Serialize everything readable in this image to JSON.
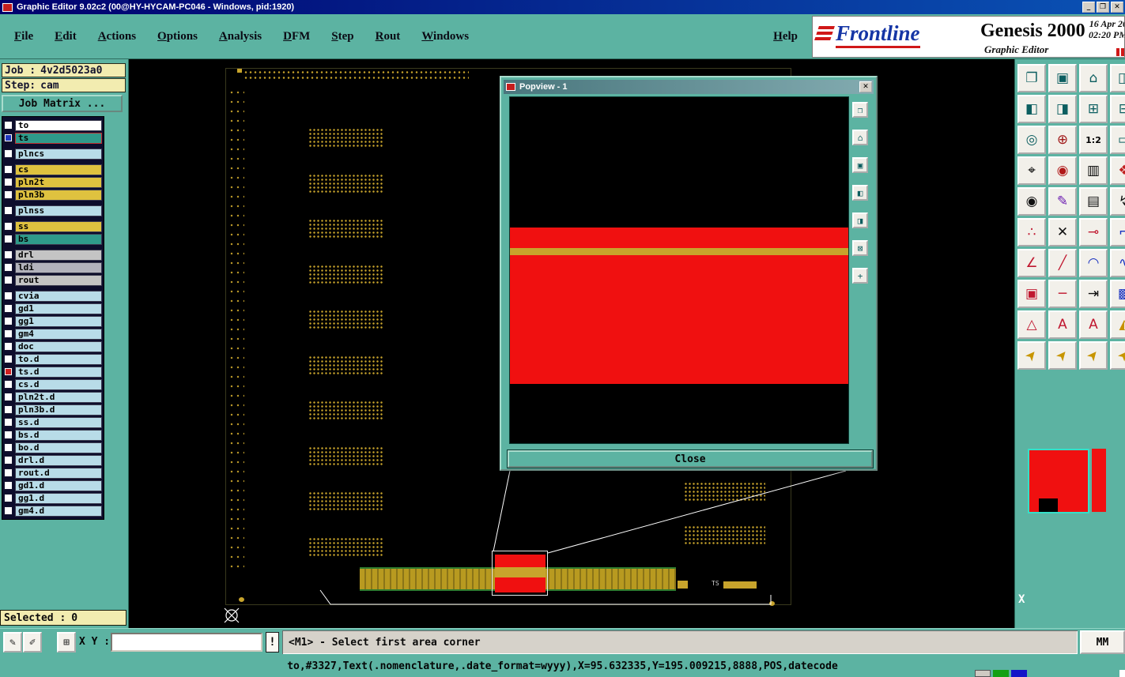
{
  "window": {
    "title": "Graphic Editor 9.02c2 (00@HY-HYCAM-PC046 - Windows, pid:1920)",
    "controls": {
      "minimize": "_",
      "maximize": "❐",
      "close": "✕"
    }
  },
  "menu": {
    "items": [
      "File",
      "Edit",
      "Actions",
      "Options",
      "Analysis",
      "DFM",
      "Step",
      "Rout",
      "Windows"
    ],
    "help": "Help"
  },
  "brand": {
    "logo": "Frontline",
    "product": "Genesis 2000",
    "date": "16 Apr 20",
    "time": "02:20 PM",
    "subtitle": "Graphic Editor"
  },
  "sidebar": {
    "job": {
      "label": "Job :",
      "value": "4v2d5023a0"
    },
    "step": {
      "label": "Step:",
      "value": "cam"
    },
    "matrix_button": "Job Matrix ...",
    "selected": {
      "label": "Selected :",
      "value": "0"
    },
    "layers": [
      {
        "name": "to",
        "bg": "#ffffff"
      },
      {
        "name": "ts",
        "bg": "#2f9a8a",
        "check": "#2038c0",
        "selected": true
      },
      {
        "name": "plncs",
        "bg": "#b8dce8",
        "gap": true
      },
      {
        "name": "cs",
        "bg": "#dfc23f",
        "gap": true
      },
      {
        "name": "pln2t",
        "bg": "#dfc23f"
      },
      {
        "name": "pln3b",
        "bg": "#dfc23f"
      },
      {
        "name": "plnss",
        "bg": "#b8dce8",
        "gap": true
      },
      {
        "name": "ss",
        "bg": "#dfc23f",
        "gap": true
      },
      {
        "name": "bs",
        "bg": "#2f9a8a"
      },
      {
        "name": "drl",
        "bg": "#c4c4c4",
        "gap": true
      },
      {
        "name": "ldi",
        "bg": "#b2b2bc"
      },
      {
        "name": "rout",
        "bg": "#c4c4c4"
      },
      {
        "name": "cvia",
        "bg": "#b8dce8",
        "gap": true
      },
      {
        "name": "gd1",
        "bg": "#b8dce8"
      },
      {
        "name": "gg1",
        "bg": "#b8dce8"
      },
      {
        "name": "gm4",
        "bg": "#b8dce8"
      },
      {
        "name": "doc",
        "bg": "#b8dce8"
      },
      {
        "name": "to.d",
        "bg": "#b8dce8"
      },
      {
        "name": "ts.d",
        "bg": "#b8dce8",
        "check": "#d02020"
      },
      {
        "name": "cs.d",
        "bg": "#b8dce8"
      },
      {
        "name": "pln2t.d",
        "bg": "#b8dce8"
      },
      {
        "name": "pln3b.d",
        "bg": "#b8dce8"
      },
      {
        "name": "ss.d",
        "bg": "#b8dce8"
      },
      {
        "name": "bs.d",
        "bg": "#b8dce8"
      },
      {
        "name": "bo.d",
        "bg": "#b8dce8"
      },
      {
        "name": "drl.d",
        "bg": "#b8dce8"
      },
      {
        "name": "rout.d",
        "bg": "#b8dce8"
      },
      {
        "name": "gd1.d",
        "bg": "#b8dce8"
      },
      {
        "name": "gg1.d",
        "bg": "#b8dce8"
      },
      {
        "name": "gm4.d",
        "bg": "#b8dce8"
      }
    ]
  },
  "canvas": {
    "ts_label": "TS"
  },
  "popview": {
    "title": "Popview - 1",
    "close_glyph": "✕",
    "close_label": "Close",
    "buttons": [
      {
        "name": "copy-window",
        "glyph": "❐"
      },
      {
        "name": "home-view",
        "glyph": "⌂"
      },
      {
        "name": "screen-view",
        "glyph": "▣"
      },
      {
        "name": "pan-left",
        "glyph": "◧"
      },
      {
        "name": "pan-right",
        "glyph": "◨"
      },
      {
        "name": "zoom-fit",
        "glyph": "⊠"
      },
      {
        "name": "pan-move",
        "glyph": "+"
      }
    ]
  },
  "toolbar": {
    "buttons": [
      {
        "name": "view-capture",
        "glyph": "❐",
        "color": "#0c5e60"
      },
      {
        "name": "view-screen",
        "glyph": "▣",
        "color": "#0c5e60"
      },
      {
        "name": "view-home",
        "glyph": "⌂",
        "color": "#0c5e60"
      },
      {
        "name": "view-window",
        "glyph": "◫",
        "color": "#0c5e60"
      },
      {
        "name": "pan-left",
        "glyph": "◧",
        "color": "#0c5e60"
      },
      {
        "name": "pan-right",
        "glyph": "◨",
        "color": "#0c5e60"
      },
      {
        "name": "zoom-in",
        "glyph": "⊞",
        "color": "#0c5e60"
      },
      {
        "name": "zoom-out",
        "glyph": "⊟",
        "color": "#0c5e60"
      },
      {
        "name": "zoom-eye",
        "glyph": "◎",
        "color": "#0c5e60"
      },
      {
        "name": "zoom-target",
        "glyph": "⊕",
        "color": "#a01818"
      },
      {
        "name": "scale-1-2",
        "glyph": "1:2",
        "color": "#000000"
      },
      {
        "name": "clear-layer",
        "glyph": "▭",
        "color": "#0c5e60"
      },
      {
        "name": "measure",
        "glyph": "⌖",
        "color": "#000000"
      },
      {
        "name": "origin-mark",
        "glyph": "◉",
        "color": "#b01818"
      },
      {
        "name": "ruler",
        "glyph": "▥",
        "color": "#000000"
      },
      {
        "name": "color-select",
        "glyph": "❖",
        "color": "#c02020"
      },
      {
        "name": "point-select",
        "glyph": "◉",
        "color": "#101010"
      },
      {
        "name": "pencil",
        "glyph": "✎",
        "color": "#6a1ab0"
      },
      {
        "name": "comb",
        "glyph": "▤",
        "color": "#101010"
      },
      {
        "name": "flash",
        "glyph": "↯",
        "color": "#101010"
      },
      {
        "name": "net-points",
        "glyph": "∴",
        "color": "#c01830"
      },
      {
        "name": "delete",
        "glyph": "✕",
        "color": "#101010"
      },
      {
        "name": "probe",
        "glyph": "⊸",
        "color": "#c01830"
      },
      {
        "name": "corner",
        "glyph": "⌐",
        "color": "#1830c0"
      },
      {
        "name": "angle",
        "glyph": "∠",
        "color": "#c01830"
      },
      {
        "name": "slope-line",
        "glyph": "╱",
        "color": "#c01830"
      },
      {
        "name": "arc",
        "glyph": "◠",
        "color": "#1830c0"
      },
      {
        "name": "wave",
        "glyph": "∿",
        "color": "#1830c0"
      },
      {
        "name": "pad-box",
        "glyph": "▣",
        "color": "#c01830"
      },
      {
        "name": "line-horiz",
        "glyph": "─",
        "color": "#c01830"
      },
      {
        "name": "tab-move",
        "glyph": "⇥",
        "color": "#101010"
      },
      {
        "name": "fill-area",
        "glyph": "▩",
        "color": "#1830c0"
      },
      {
        "name": "tri-outline",
        "glyph": "△",
        "color": "#c01830"
      },
      {
        "name": "text-a",
        "glyph": "A",
        "color": "#c01830"
      },
      {
        "name": "text-a2",
        "glyph": "A",
        "color": "#c01830"
      },
      {
        "name": "tri-solid",
        "glyph": "◭",
        "color": "#c79000"
      },
      {
        "name": "cursor-1",
        "glyph": "➤",
        "color": "#c79500",
        "rot": -50
      },
      {
        "name": "cursor-2",
        "glyph": "➤",
        "color": "#c79500",
        "rot": -50
      },
      {
        "name": "cursor-3",
        "glyph": "➤",
        "color": "#c79500",
        "rot": -50
      },
      {
        "name": "cursor-4",
        "glyph": "➤",
        "color": "#c79500",
        "rot": -50
      }
    ]
  },
  "minimap": {
    "x_label": "X"
  },
  "statusbar": {
    "xy_label": "X Y :",
    "xy_value": "",
    "alert": "!",
    "message": "<M1> - Select first area corner",
    "units": "MM",
    "buttons": [
      {
        "name": "sketch-tool",
        "glyph": "✎"
      },
      {
        "name": "measure-tool",
        "glyph": "✐"
      },
      {
        "name": "grid-toggle",
        "glyph": "⊞"
      }
    ]
  },
  "footer": {
    "text": "to,#3327,Text(.nomenclature,.date_format=wyyy),X=95.632335,Y=195.009215,8888,POS,datecode"
  },
  "colors": {
    "teal_bg": "#5cb3a2",
    "title_navy": "#00006e",
    "pcb_gold": "#c8a42c",
    "highlight_red": "#f01010",
    "layer_gold": "#dfc23f",
    "layer_blue": "#b8dce8",
    "layer_teal": "#2f9a8a"
  }
}
